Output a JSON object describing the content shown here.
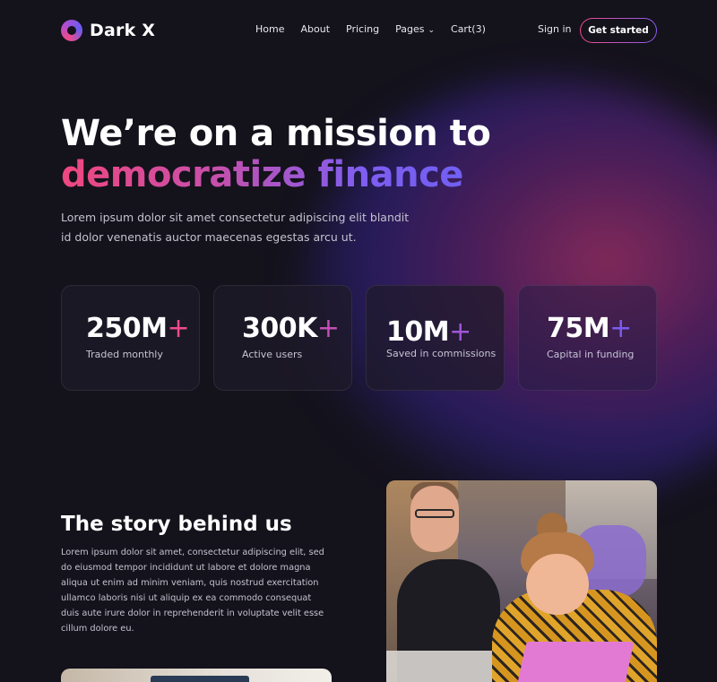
{
  "brand": {
    "name": "Dark X",
    "logo_icon": "ring-logo-icon"
  },
  "nav": {
    "items": [
      {
        "label": "Home"
      },
      {
        "label": "About"
      },
      {
        "label": "Pricing"
      },
      {
        "label": "Pages",
        "icon": "chevron-down-icon"
      },
      {
        "label": "Cart(3)"
      }
    ]
  },
  "header": {
    "signin_label": "Sign in",
    "cta_label": "Get started"
  },
  "hero": {
    "title_line1": "We’re on a mission to",
    "title_highlight": "democratize finance",
    "subtitle": "Lorem ipsum dolor sit amet consectetur adipiscing elit blandit id dolor venenatis auctor maecenas egestas arcu ut."
  },
  "stats": [
    {
      "value": "250M",
      "plus": "+",
      "label": "Traded monthly",
      "accent": "#ef4b8b"
    },
    {
      "value": "300K",
      "plus": "+",
      "label": "Active users",
      "accent": "#c44fb4"
    },
    {
      "value": "10M",
      "plus": "+",
      "label": "Saved in commissions",
      "accent": "#a256d8"
    },
    {
      "value": "75M",
      "plus": "+",
      "label": "Capital in funding",
      "accent": "#7a5cf0"
    }
  ],
  "story": {
    "title": "The story behind us",
    "body": "Lorem ipsum dolor sit amet, consectetur adipiscing elit, sed do eiusmod tempor incididunt ut labore et dolore magna aliqua ut enim ad minim veniam, quis nostrud exercitation ullamco laboris nisi ut aliquip ex ea commodo consequat duis aute irure dolor in reprehenderit in voluptate velit esse cillum dolore eu."
  },
  "colors": {
    "background": "#14121b",
    "gradient_start": "#f0477f",
    "gradient_end": "#6c60f2"
  }
}
